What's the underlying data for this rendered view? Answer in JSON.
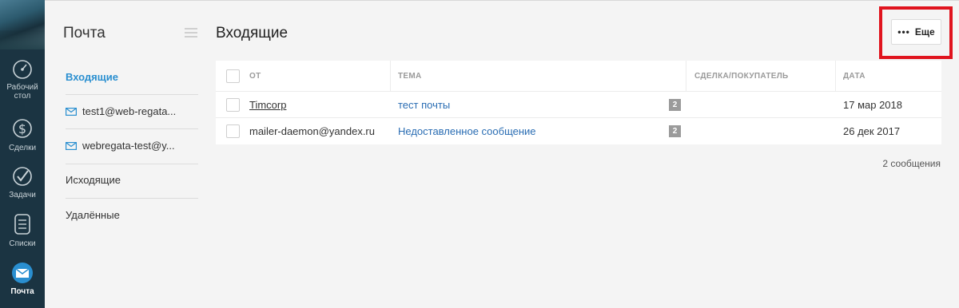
{
  "rail": {
    "items": [
      {
        "label": "Рабочий стол",
        "icon": "dashboard-icon"
      },
      {
        "label": "Сделки",
        "icon": "dollar-icon"
      },
      {
        "label": "Задачи",
        "icon": "checkmark-icon"
      },
      {
        "label": "Списки",
        "icon": "list-icon"
      },
      {
        "label": "Почта",
        "icon": "mail-icon",
        "active": true
      }
    ]
  },
  "sidebar": {
    "title": "Почта",
    "folders": [
      {
        "label": "Входящие",
        "active": true
      },
      {
        "label": "test1@web-regata...",
        "icon": "envelope-icon"
      },
      {
        "label": "webregata-test@y...",
        "icon": "envelope-icon"
      },
      {
        "label": "Исходящие"
      },
      {
        "label": "Удалённые"
      }
    ]
  },
  "main": {
    "title": "Входящие",
    "more_button": {
      "label": "Еще",
      "icon": "more-dots-icon"
    },
    "table": {
      "columns": [
        "ОТ",
        "ТЕМА",
        "СДЕЛКА/ПОКУПАТЕЛЬ",
        "ДАТА"
      ],
      "rows": [
        {
          "from": "Timcorp",
          "subject": "тест почты",
          "count": "2",
          "deal": "",
          "date": "17 мар 2018"
        },
        {
          "from": "mailer-daemon@yandex.ru",
          "subject": "Недоставленное сообщение",
          "count": "2",
          "deal": "",
          "date": "26 дек 2017"
        }
      ]
    },
    "message_count": "2 сообщения"
  },
  "colors": {
    "rail_bg": "#1b3442",
    "accent": "#2a8fd0",
    "subject_link": "#2a6db3",
    "highlight": "#e0141e"
  }
}
